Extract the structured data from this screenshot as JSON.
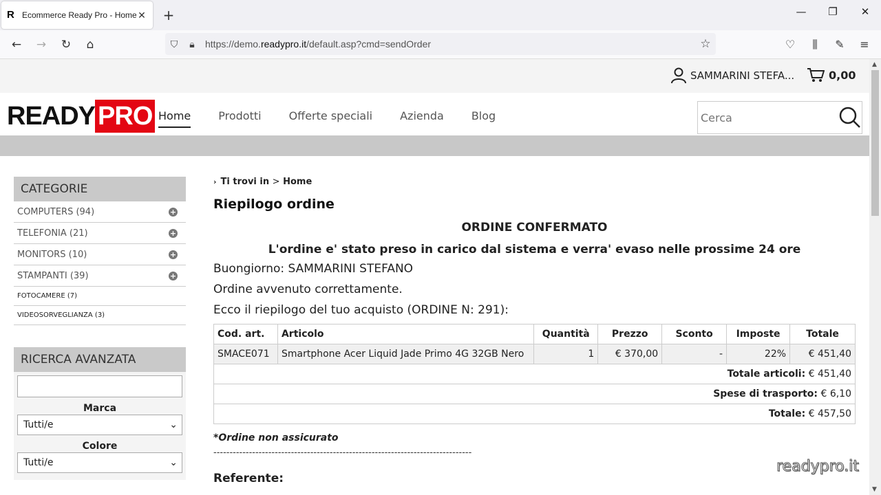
{
  "browser": {
    "tab_title": "Ecommerce Ready Pro - Home",
    "url_prefix": "https://demo.",
    "url_domain": "readypro.it",
    "url_suffix": "/default.asp?cmd=sendOrder"
  },
  "topbar": {
    "user_name": "SAMMARINI STEFA...",
    "cart_total": "0,00"
  },
  "header": {
    "logo_ready": "READY",
    "logo_pro": "PRO",
    "menu": [
      "Home",
      "Prodotti",
      "Offerte speciali",
      "Azienda",
      "Blog"
    ],
    "search_placeholder": "Cerca"
  },
  "sidebar": {
    "categories_title": "CATEGORIE",
    "categories": [
      {
        "label": "COMPUTERS (94)"
      },
      {
        "label": "TELEFONIA (21)"
      },
      {
        "label": "MONITORS (10)"
      },
      {
        "label": "STAMPANTI (39)"
      },
      {
        "label": "FOTOCAMERE (7)"
      },
      {
        "label": "VIDEOSORVEGLIANZA (3)"
      }
    ],
    "advanced_title": "RICERCA AVANZATA",
    "brand_label": "Marca",
    "brand_value": "Tutti/e",
    "color_label": "Colore",
    "color_value": "Tutti/e"
  },
  "content": {
    "breadcrumb_prefix": "Ti trovi in",
    "breadcrumb_sep": ">",
    "breadcrumb_current": "Home",
    "page_title": "Riepilogo ordine",
    "confirmed": "ORDINE CONFERMATO",
    "confirmed_sub": "L'ordine e' stato preso in carico dal sistema e verra' evaso nelle prossime 24 ore",
    "greeting": "Buongiorno: SAMMARINI STEFANO",
    "success": "Ordine avvenuto correttamente.",
    "summary_intro": "Ecco il riepilogo del tuo acquisto (ORDINE N: 291):",
    "table": {
      "headers": [
        "Cod. art.",
        "Articolo",
        "Quantità",
        "Prezzo",
        "Sconto",
        "Imposte",
        "Totale"
      ],
      "rows": [
        [
          "SMACE071",
          "Smartphone Acer Liquid Jade Primo 4G 32GB Nero",
          "1",
          "€ 370,00",
          "-",
          "22%",
          "€ 451,40"
        ]
      ],
      "total_items_label": "Totale articoli:",
      "total_items_value": "€ 451,40",
      "shipping_label": "Spese di trasporto:",
      "shipping_value": "€ 6,10",
      "total_label": "Totale:",
      "total_value": "€ 457,50"
    },
    "note": "*Ordine non assicurato",
    "dashes": "--------------------------------------------------------------------------------",
    "next_heading": "Referente:"
  },
  "watermark": "readypro.it"
}
